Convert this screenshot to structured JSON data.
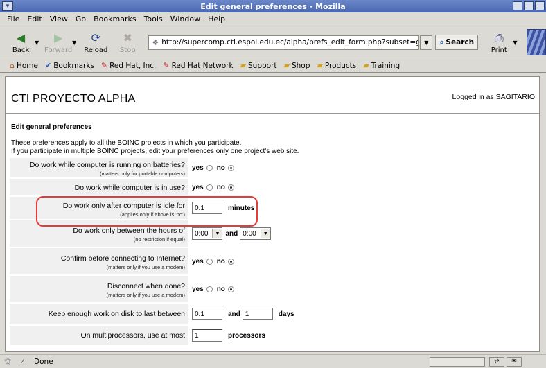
{
  "window": {
    "title": "Edit general preferences - Mozilla"
  },
  "menu": [
    "File",
    "Edit",
    "View",
    "Go",
    "Bookmarks",
    "Tools",
    "Window",
    "Help"
  ],
  "nav": {
    "back": "Back",
    "forward": "Forward",
    "reload": "Reload",
    "stop": "Stop",
    "url": "http://supercomp.cti.espol.edu.ec/alpha/prefs_edit_form.php?subset=global",
    "search": "Search",
    "print": "Print"
  },
  "bookmarks": [
    {
      "label": "Home",
      "icon": "home-icon"
    },
    {
      "label": "Bookmarks",
      "icon": "bookmarks-icon"
    },
    {
      "label": "Red Hat, Inc.",
      "icon": "redhat-icon"
    },
    {
      "label": "Red Hat Network",
      "icon": "redhat-icon"
    },
    {
      "label": "Support",
      "icon": "folder-icon"
    },
    {
      "label": "Shop",
      "icon": "folder-icon"
    },
    {
      "label": "Products",
      "icon": "folder-icon"
    },
    {
      "label": "Training",
      "icon": "folder-icon"
    }
  ],
  "page": {
    "site_title": "CTI PROYECTO ALPHA",
    "logged_in": "Logged in as SAGITARIO",
    "section_title": "Edit general preferences",
    "intro_line1": "These preferences apply to all the BOINC projects in which you participate.",
    "intro_line2": "If you participate in multiple BOINC projects, edit your preferences only one project's web site."
  },
  "prefs": {
    "batteries": {
      "label": "Do work while computer is running on batteries?",
      "note": "(matters only for portable computers)",
      "yes": "yes",
      "no": "no",
      "selected": "no"
    },
    "in_use": {
      "label": "Do work while computer is in use?",
      "yes": "yes",
      "no": "no",
      "selected": "no"
    },
    "idle": {
      "label": "Do work only after computer is idle for",
      "note": "(applies only if above is 'no')",
      "value": "0.1",
      "unit": "minutes"
    },
    "hours": {
      "label": "Do work only between the hours of",
      "note": "(no restriction if equal)",
      "from": "0:00",
      "and": "and",
      "to": "0:00"
    },
    "confirm": {
      "label": "Confirm before connecting to Internet?",
      "note": "(matters only if you use a modem)",
      "yes": "yes",
      "no": "no",
      "selected": "no"
    },
    "disconnect": {
      "label": "Disconnect when done?",
      "note": "(matters only if you use a modem)",
      "yes": "yes",
      "no": "no",
      "selected": "no"
    },
    "work_buffer": {
      "label": "Keep enough work on disk to last between",
      "min": "0.1",
      "and": "and",
      "max": "1",
      "unit": "days"
    },
    "processors": {
      "label": "On multiprocessors, use at most",
      "value": "1",
      "unit": "processors"
    }
  },
  "status": {
    "text": "Done"
  },
  "colors": {
    "titlebar": "#4a67b0",
    "highlight": "#e53b3b",
    "label_bg": "#f0f0f0"
  }
}
